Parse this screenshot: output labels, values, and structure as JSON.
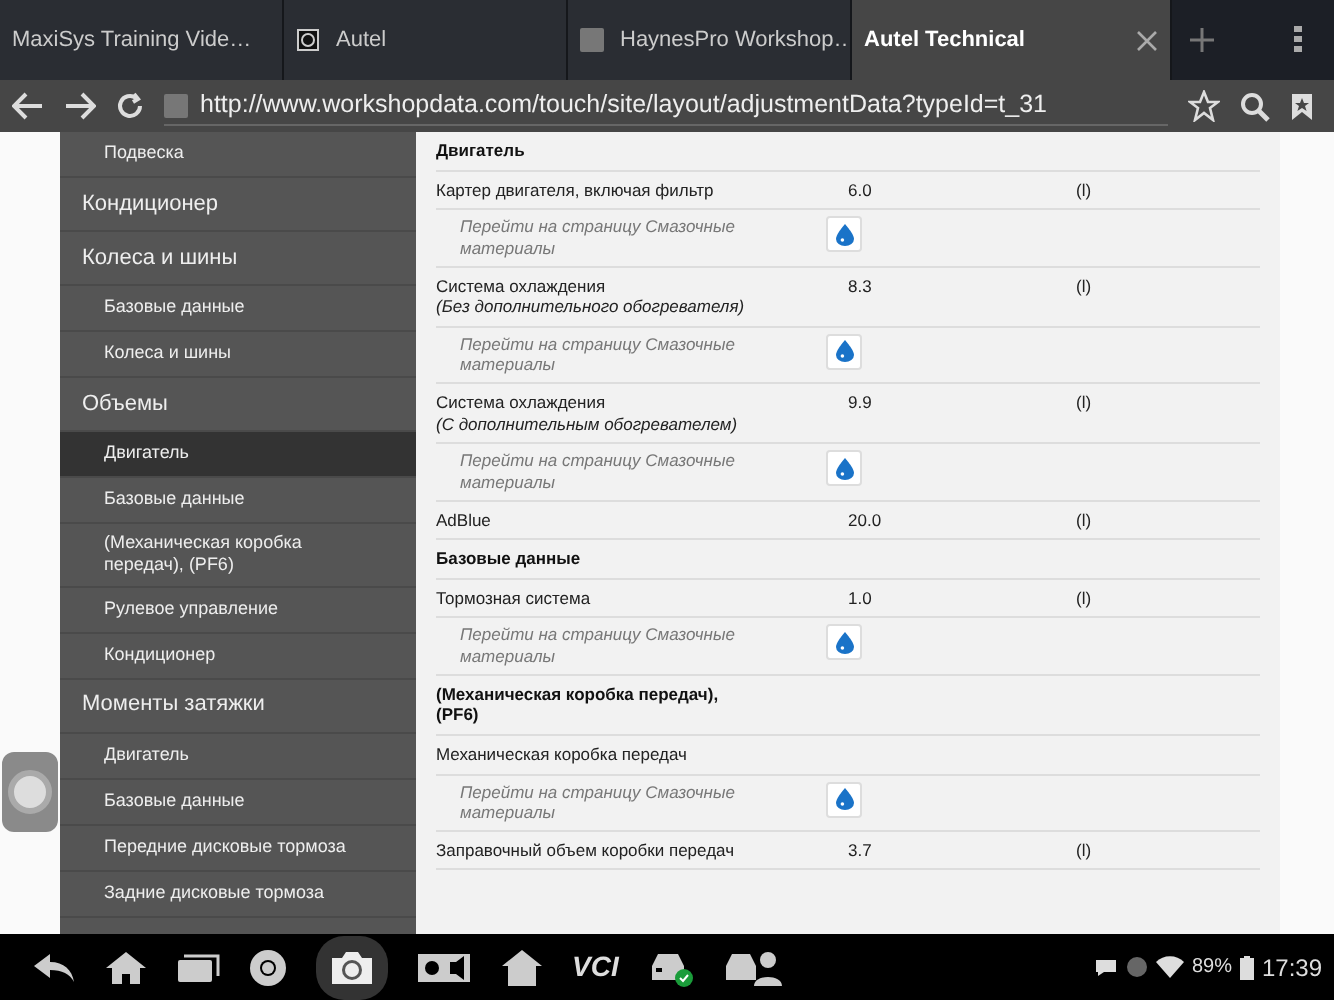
{
  "tabs": [
    {
      "label": "MaxiSys Training Vide…",
      "selected": false,
      "kind": "plain"
    },
    {
      "label": "Autel",
      "selected": false,
      "kind": "logo"
    },
    {
      "label": "HaynesPro Workshop…",
      "selected": false,
      "kind": "square"
    },
    {
      "label": "Autel Technical",
      "selected": true,
      "kind": "plain"
    }
  ],
  "address_bar": {
    "url": "http://www.workshopdata.com/touch/site/layout/adjustmentData?typeId=t_31"
  },
  "sidebar": {
    "items": [
      {
        "kind": "sub",
        "label": "Подвеска",
        "selected": false
      },
      {
        "kind": "group",
        "label": "Кондиционер",
        "selected": false
      },
      {
        "kind": "group",
        "label": "Колеса и шины",
        "selected": false
      },
      {
        "kind": "sub",
        "label": "Базовые данные",
        "selected": false
      },
      {
        "kind": "sub",
        "label": "Колеса и шины",
        "selected": false
      },
      {
        "kind": "group",
        "label": "Объемы",
        "selected": false
      },
      {
        "kind": "sub",
        "label": "Двигатель",
        "selected": true
      },
      {
        "kind": "sub",
        "label": "Базовые данные",
        "selected": false
      },
      {
        "kind": "sub",
        "label": "(Механическая коробка передач), (PF6)",
        "selected": false
      },
      {
        "kind": "sub",
        "label": "Рулевое управление",
        "selected": false
      },
      {
        "kind": "sub",
        "label": "Кондиционер",
        "selected": false
      },
      {
        "kind": "group",
        "label": "Моменты затяжки",
        "selected": false
      },
      {
        "kind": "sub",
        "label": "Двигатель",
        "selected": false
      },
      {
        "kind": "sub",
        "label": "Базовые данные",
        "selected": false
      },
      {
        "kind": "sub",
        "label": "Передние дисковые тормоза",
        "selected": false
      },
      {
        "kind": "sub",
        "label": "Задние дисковые тормоза",
        "selected": false
      }
    ]
  },
  "content": {
    "rows": [
      {
        "kind": "section",
        "label": "Двигатель"
      },
      {
        "kind": "item",
        "label": "Картер двигателя, включая фильтр",
        "value": "6.0",
        "unit": "(l)"
      },
      {
        "kind": "link",
        "label": "Перейти на страницу Смазочные материалы"
      },
      {
        "kind": "item",
        "label": "Система охлаждения",
        "note": "(Без дополнительного обогревателя)",
        "value": "8.3",
        "unit": "(l)"
      },
      {
        "kind": "link",
        "label": "Перейти на страницу Смазочные материалы"
      },
      {
        "kind": "item",
        "label": "Система охлаждения",
        "note": "(С дополнительным обогревателем)",
        "value": "9.9",
        "unit": "(l)"
      },
      {
        "kind": "link",
        "label": "Перейти на страницу Смазочные материалы"
      },
      {
        "kind": "item",
        "label": "AdBlue",
        "value": "20.0",
        "unit": "(l)"
      },
      {
        "kind": "section",
        "label": "Базовые данные"
      },
      {
        "kind": "item",
        "label": "Тормозная система",
        "value": "1.0",
        "unit": "(l)"
      },
      {
        "kind": "link",
        "label": "Перейти на страницу Смазочные материалы"
      },
      {
        "kind": "section",
        "label": "(Механическая коробка передач), (PF6)"
      },
      {
        "kind": "item",
        "label": "Механическая коробка передач"
      },
      {
        "kind": "link",
        "label": "Перейти на страницу Смазочные материалы"
      },
      {
        "kind": "item",
        "label": "Заправочный объем коробки передач",
        "value": "3.7",
        "unit": "(l)"
      }
    ]
  },
  "system_bar": {
    "vci_label": "VCI",
    "battery": "89%",
    "time": "17:39"
  }
}
